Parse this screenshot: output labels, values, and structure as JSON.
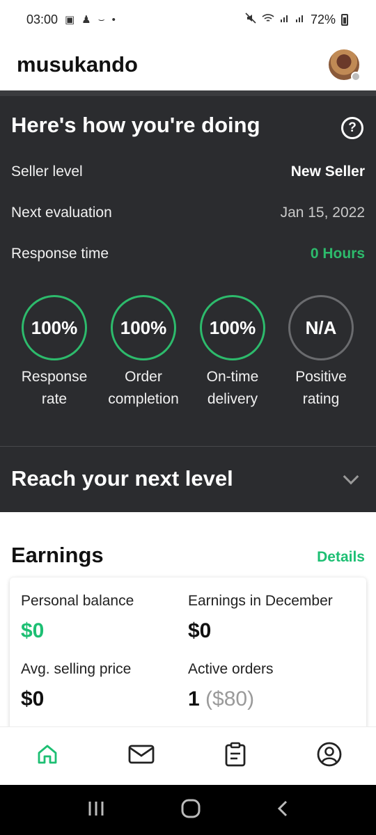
{
  "status_bar": {
    "time": "03:00",
    "battery": "72%",
    "left_icons": [
      "image-icon",
      "accessibility-icon",
      "amazon-smile-icon",
      "dot-icon"
    ],
    "right_icons": [
      "mute-icon",
      "wifi-icon",
      "signal-icon",
      "signal-icon",
      "battery-icon"
    ]
  },
  "app_bar": {
    "title": "musukando",
    "avatar_status_color": "#bdbdbd"
  },
  "performance": {
    "heading": "Here's how you're doing",
    "help_icon": "?",
    "rows": [
      {
        "label": "Seller level",
        "value": "New Seller",
        "color": "#ffffff"
      },
      {
        "label": "Next evaluation",
        "value": "Jan 15, 2022",
        "color": "#c9c9c9"
      },
      {
        "label": "Response time",
        "value": "0 Hours",
        "color": "#2dbb6c"
      }
    ],
    "metrics": [
      {
        "value": "100%",
        "line1": "Response",
        "line2": "rate"
      },
      {
        "value": "100%",
        "line1": "Order",
        "line2": "completion"
      },
      {
        "value": "100%",
        "line1": "On-time",
        "line2": "delivery"
      },
      {
        "value": "N/A",
        "line1": "Positive",
        "line2": "rating"
      }
    ],
    "next_level": "Reach your next level"
  },
  "earnings": {
    "heading": "Earnings",
    "details_link": "Details",
    "personal_balance_label": "Personal balance",
    "personal_balance": "$0",
    "month_earnings_label": "Earnings in December",
    "month_earnings": "$0",
    "avg_price_label": "Avg. selling price",
    "avg_price": "$0",
    "active_orders_label": "Active orders",
    "active_orders_count": "1",
    "active_orders_value": "($80)"
  },
  "bottom_nav": [
    "home-icon",
    "inbox-icon",
    "orders-icon",
    "profile-icon"
  ],
  "colors": {
    "accent": "#1dbf73",
    "dark_panel": "#2b2c2f"
  }
}
